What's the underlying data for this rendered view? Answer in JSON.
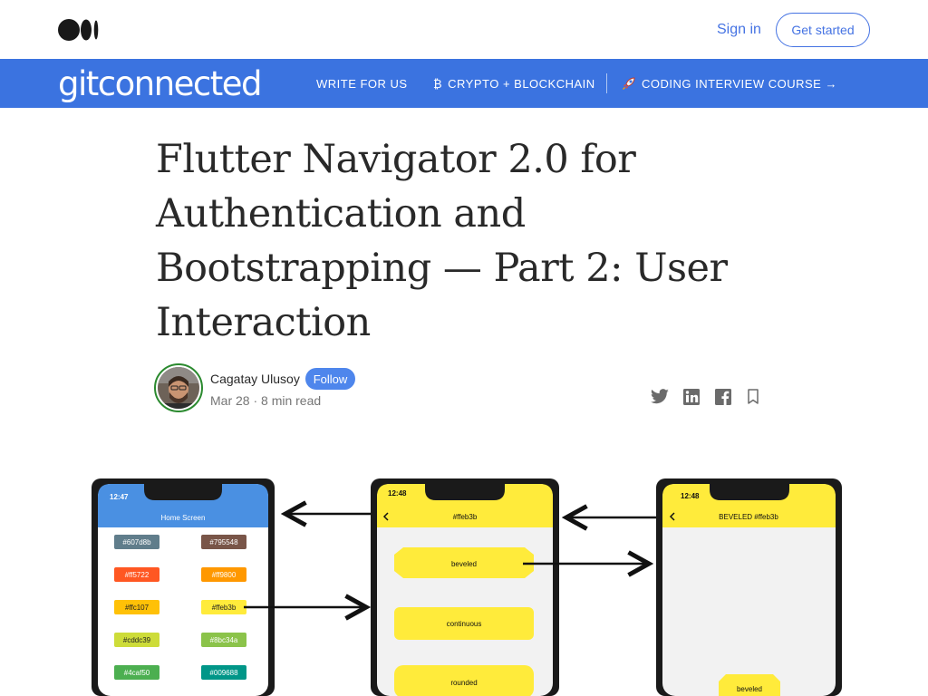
{
  "header": {
    "signin_label": "Sign in",
    "getstarted_label": "Get started"
  },
  "publication": {
    "logo_text": "gitconnected",
    "nav": [
      {
        "label": "WRITE FOR US",
        "icon": ""
      },
      {
        "label": "CRYPTO + BLOCKCHAIN",
        "icon": "bitcoin-icon",
        "prefix": "₿"
      },
      {
        "label": "CODING INTERVIEW COURSE →",
        "icon": "rocket-icon"
      }
    ]
  },
  "article": {
    "title": "Flutter Navigator 2.0 for Authentication and Bootstrapping — Part 2: User Interaction",
    "author": "Cagatay Ulusoy",
    "follow_label": "Follow",
    "meta": "Mar 28 · 8 min read"
  },
  "hero": {
    "phone1": {
      "time": "12:47",
      "title": "Home Screen",
      "chips": [
        {
          "label": "#607d8b",
          "color": "#607d8b"
        },
        {
          "label": "#795548",
          "color": "#795548"
        },
        {
          "label": "#ff5722",
          "color": "#ff5722"
        },
        {
          "label": "#ff9800",
          "color": "#ff9800"
        },
        {
          "label": "#ffc107",
          "color": "#ffc107"
        },
        {
          "label": "#ffeb3b",
          "color": "#ffeb3b"
        },
        {
          "label": "#cddc39",
          "color": "#cddc39"
        },
        {
          "label": "#8bc34a",
          "color": "#8bc34a"
        },
        {
          "label": "#4caf50",
          "color": "#4caf50"
        },
        {
          "label": "#009688",
          "color": "#009688"
        }
      ]
    },
    "phone2": {
      "time": "12:48",
      "title": "#ffeb3b",
      "buttons": [
        "beveled",
        "continuous",
        "rounded"
      ]
    },
    "phone3": {
      "time": "12:48",
      "title": "BEVELED #ffeb3b",
      "button": "beveled"
    },
    "colors": {
      "accent": "#3b73e0",
      "phone1_bar": "#4a90e2",
      "yellow": "#ffeb3b"
    }
  }
}
